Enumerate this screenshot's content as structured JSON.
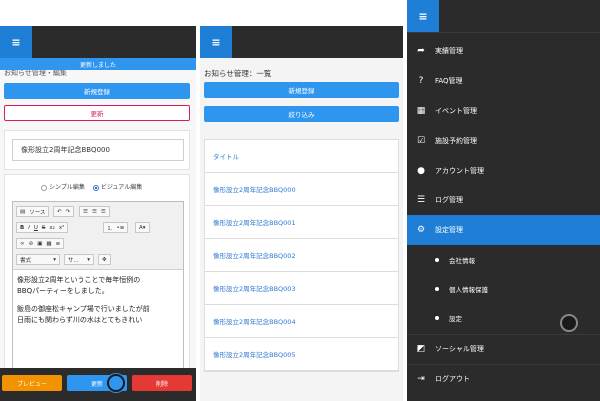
{
  "panel_edit": {
    "menu_icon": "≡",
    "toast": "更新しました",
    "heading_partial": "お知らせ管理・編集",
    "new_button": "新規登録",
    "update_button": "更新",
    "title_value": "像形設立2周年記念BBQ000",
    "editor_modes": {
      "simple": "シンプル編集",
      "visual": "ビジュアル編集"
    },
    "toolbar": {
      "source": "ソース",
      "format": "書式",
      "size": "サ..."
    },
    "body_text": [
      "像形設立2周年ということで毎年恒例の",
      "BBQパーティーをしました。",
      "飯島の御座松キャンプ場で行いましたが前",
      "日雨にも関わらず川の水はとてもきれい"
    ],
    "bottom": {
      "preview": "プレビュー",
      "update": "更新",
      "delete": "削除"
    }
  },
  "panel_list": {
    "menu_icon": "≡",
    "title": "お知らせ管理：一覧",
    "new_button": "新規登録",
    "filter_button": "絞り込み",
    "header": "タイトル",
    "rows": [
      "像形設立2周年記念BBQ000",
      "像形設立2周年記念BBQ001",
      "像形設立2周年記念BBQ002",
      "像形設立2周年記念BBQ003",
      "像形設立2周年記念BBQ004",
      "像形設立2周年記念BBQ005"
    ]
  },
  "panel_nav": {
    "menu_icon": "≡",
    "items": [
      {
        "icon": "share-icon",
        "glyph": "➦",
        "label": "実績管理"
      },
      {
        "icon": "question-icon",
        "glyph": "?",
        "label": "FAQ管理"
      },
      {
        "icon": "calendar-icon",
        "glyph": "▦",
        "label": "イベント管理"
      },
      {
        "icon": "calendar-check-icon",
        "glyph": "☑",
        "label": "施設予約管理"
      },
      {
        "icon": "user-icon",
        "glyph": "●",
        "label": "アカウント管理"
      },
      {
        "icon": "list-icon",
        "glyph": "☰",
        "label": "ログ管理"
      },
      {
        "icon": "gear-icon",
        "glyph": "⚙",
        "label": "設定管理"
      }
    ],
    "subitems": [
      "会社情報",
      "個人情報保護",
      "設定"
    ],
    "bottom_items": [
      {
        "icon": "external-link-icon",
        "glyph": "◩",
        "label": "ソーシャル管理"
      },
      {
        "icon": "logout-icon",
        "glyph": "⇥",
        "label": "ログアウト"
      }
    ]
  }
}
